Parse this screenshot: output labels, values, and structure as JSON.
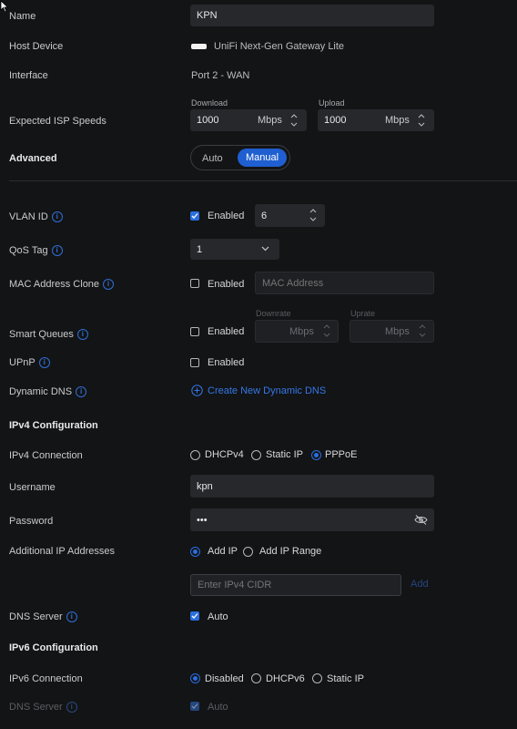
{
  "general": {
    "name_label": "Name",
    "name_value": "KPN",
    "host_device_label": "Host Device",
    "host_device_value": "UniFi Next-Gen Gateway Lite",
    "interface_label": "Interface",
    "interface_value": "Port 2 - WAN",
    "isp_speeds_label": "Expected ISP Speeds",
    "download_label": "Download",
    "download_value": "1000",
    "upload_label": "Upload",
    "upload_value": "1000",
    "speed_unit": "Mbps"
  },
  "advanced": {
    "label": "Advanced",
    "options": [
      "Auto",
      "Manual"
    ],
    "selected": "Manual"
  },
  "vlan": {
    "label": "VLAN ID",
    "enabled_label": "Enabled",
    "enabled": true,
    "value": "6"
  },
  "qos": {
    "label": "QoS Tag",
    "value": "1"
  },
  "mac_clone": {
    "label": "MAC Address Clone",
    "enabled_label": "Enabled",
    "enabled": false,
    "placeholder": "MAC Address"
  },
  "smart_queues": {
    "label": "Smart Queues",
    "enabled_label": "Enabled",
    "enabled": false,
    "downrate_label": "Downrate",
    "uprate_label": "Uprate",
    "unit": "Mbps"
  },
  "upnp": {
    "label": "UPnP",
    "enabled_label": "Enabled",
    "enabled": false
  },
  "ddns": {
    "label": "Dynamic DNS",
    "action": "Create New Dynamic DNS"
  },
  "ipv4": {
    "section_title": "IPv4 Configuration",
    "connection_label": "IPv4 Connection",
    "options": [
      "DHCPv4",
      "Static IP",
      "PPPoE"
    ],
    "selected": "PPPoE",
    "username_label": "Username",
    "username_value": "kpn",
    "password_label": "Password",
    "password_value": "•••",
    "additional_ip_label": "Additional IP Addresses",
    "additional_options": [
      "Add IP",
      "Add IP Range"
    ],
    "additional_selected": "Add IP",
    "cidr_placeholder": "Enter IPv4 CIDR",
    "add_label": "Add",
    "dns_label": "DNS Server",
    "dns_auto_label": "Auto",
    "dns_auto": true
  },
  "ipv6": {
    "section_title": "IPv6 Configuration",
    "connection_label": "IPv6 Connection",
    "options": [
      "Disabled",
      "DHCPv6",
      "Static IP"
    ],
    "selected": "Disabled",
    "dns_label": "DNS Server",
    "dns_auto_label": "Auto",
    "dns_auto": true
  },
  "colors": {
    "accent": "#2a6ee0",
    "background": "#131416",
    "input_bg": "#26282c"
  }
}
